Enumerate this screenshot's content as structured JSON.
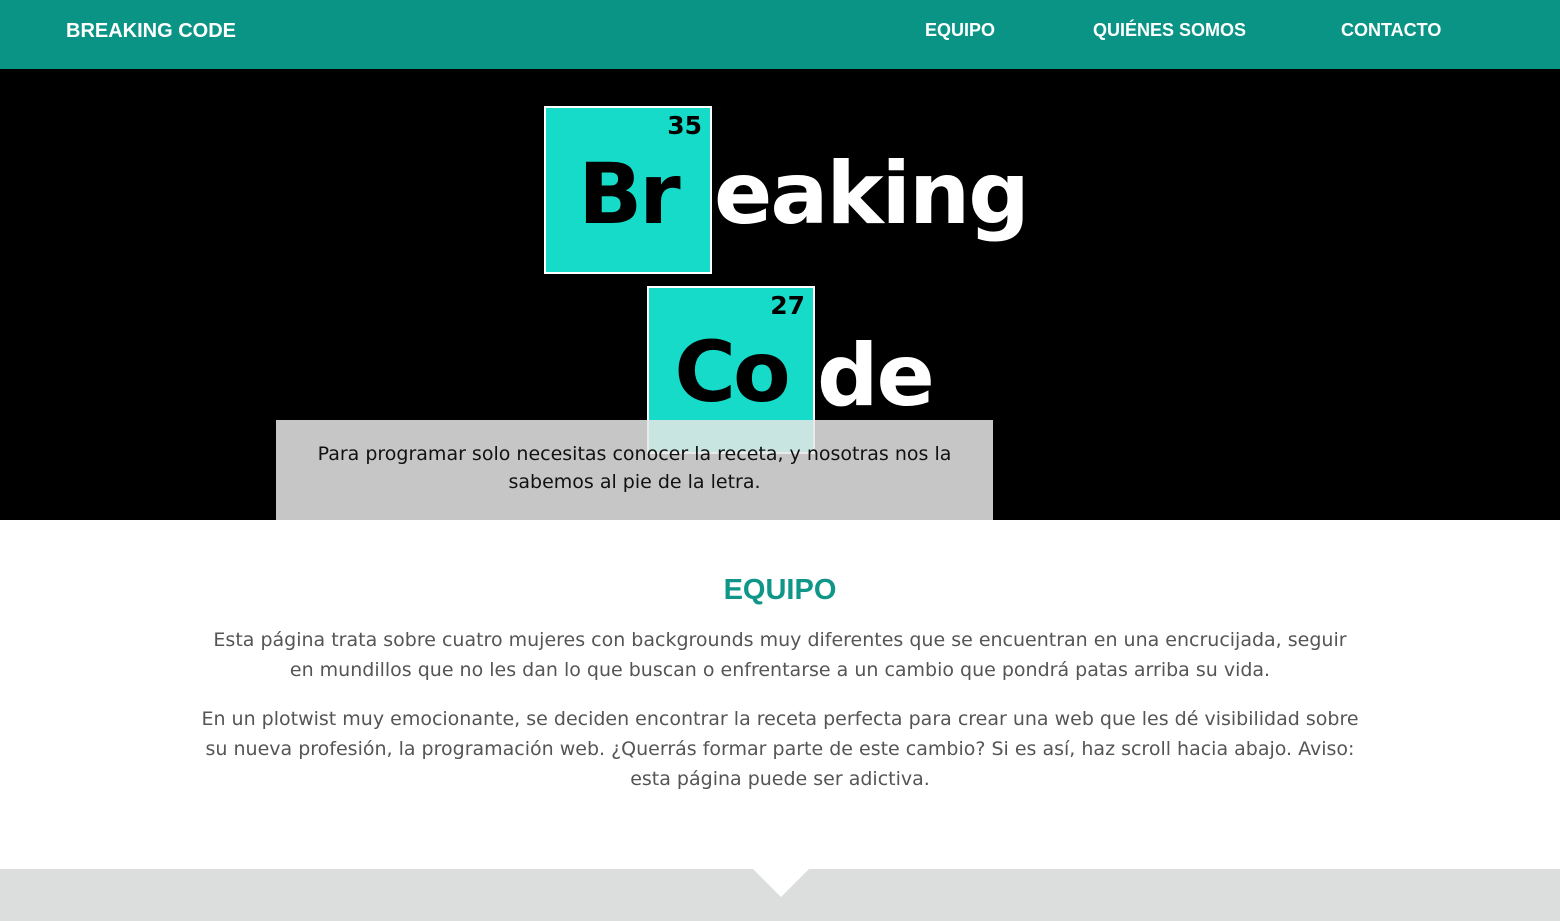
{
  "navbar": {
    "brand": "BREAKING CODE",
    "links": [
      "EQUIPO",
      "QUIÉNES SOMOS",
      "CONTACTO"
    ],
    "background": "#0a9485"
  },
  "hero": {
    "logo": {
      "line1": {
        "number": "35",
        "symbol": "Br",
        "rest": "eaking"
      },
      "line2": {
        "number": "27",
        "symbol": "Co",
        "rest": "de"
      },
      "tile_color": "#16dbc8"
    },
    "tagline": "Para programar solo necesitas conocer la receta, y nosotras nos la sabemos al pie de la letra."
  },
  "equipo": {
    "title": "EQUIPO",
    "paragraphs": [
      "Esta página trata sobre cuatro mujeres con backgrounds muy diferentes que se encuentran en una encrucijada, seguir en mundillos que no les dan lo que buscan o enfrentarse a un cambio que pondrá patas arriba su vida.",
      "En un plotwist muy emocionante, se deciden encontrar la receta perfecta para crear una web que les dé visibilidad sobre su nueva profesión, la programación web. ¿Querrás formar parte de este cambio? Si es así, haz scroll hacia abajo. Aviso: esta página puede ser adictiva."
    ],
    "title_color": "#0f9688"
  }
}
